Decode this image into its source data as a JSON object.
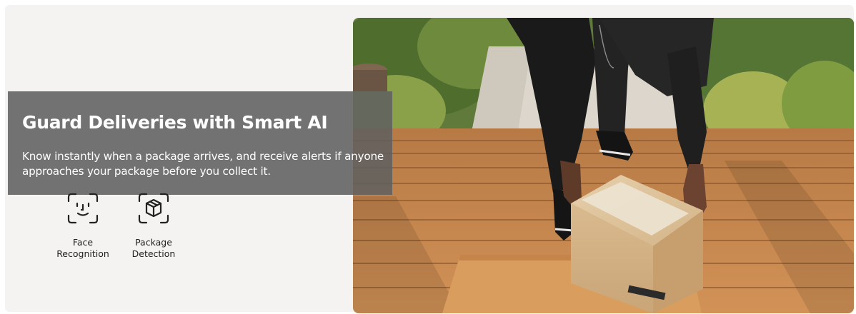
{
  "banner": {
    "headline": "Guard Deliveries with Smart AI",
    "description": "Know instantly when a package arrives, and receive alerts if anyone approaches your package before you collect it."
  },
  "features": [
    {
      "icon": "face-scan-icon",
      "label_line1": "Face",
      "label_line2": "Recognition"
    },
    {
      "icon": "package-scan-icon",
      "label_line1": "Package",
      "label_line2": "Detection"
    }
  ],
  "photo": {
    "subject": "person-picking-up-package-on-porch"
  },
  "colors": {
    "panel_background": "#f4f3f1",
    "overlay": "#606060",
    "deck": "#c98a4f",
    "doormat": "#d89a5b",
    "box": "#d9bb92"
  }
}
